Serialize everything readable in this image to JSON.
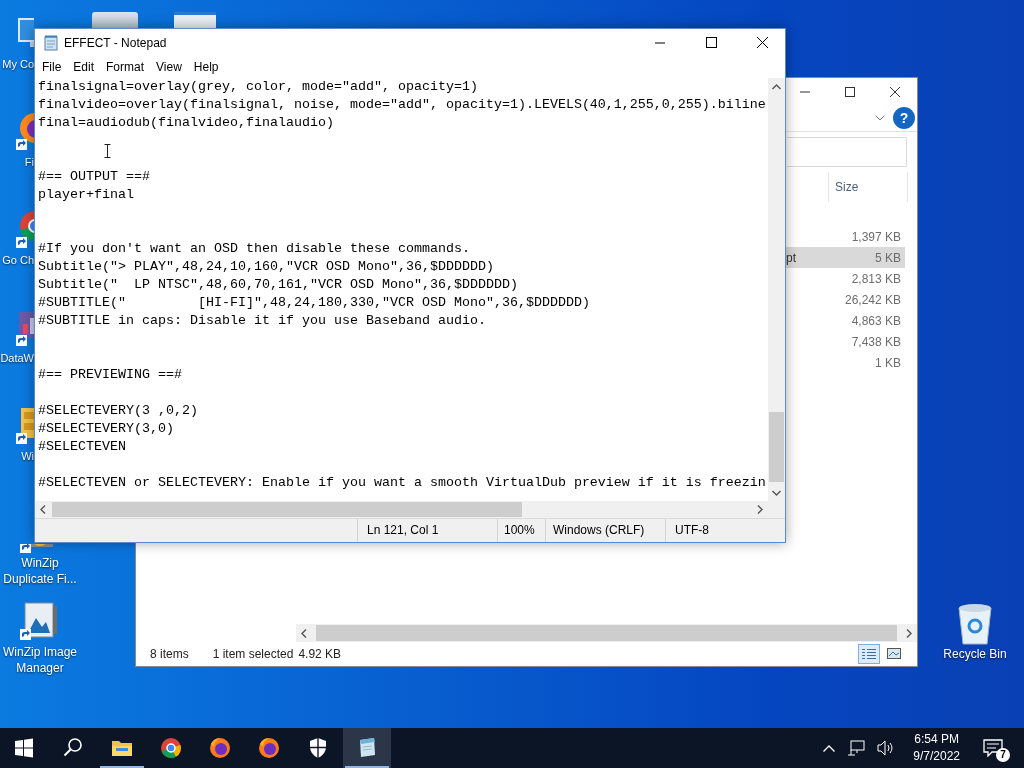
{
  "desktop_icons": [
    {
      "kind": "computer",
      "label": "My Co",
      "cut": true
    },
    {
      "kind": "fox",
      "label": "Fi",
      "cut": true
    },
    {
      "kind": "browser",
      "label": "Go Ch",
      "cut": true
    },
    {
      "kind": "chart",
      "label": "DataW",
      "cut": true
    },
    {
      "kind": "cabinet",
      "label": "Wi",
      "cut": true
    },
    {
      "kind": "zip",
      "label": "WinZip Duplicate Fi...",
      "cut": false
    },
    {
      "kind": "image",
      "label": "WinZip Image Manager",
      "cut": false
    }
  ],
  "recycle_bin": {
    "label": "Recycle Bin"
  },
  "explorer": {
    "help": "?",
    "size_header": "Size",
    "rows": [
      {
        "size": "1,397 KB",
        "selected": false
      },
      {
        "name": "pt",
        "size": "5 KB",
        "selected": true
      },
      {
        "size": "2,813 KB",
        "selected": false
      },
      {
        "size": "26,242 KB",
        "selected": false
      },
      {
        "size": "4,863 KB",
        "selected": false
      },
      {
        "size": "7,438 KB",
        "selected": false
      },
      {
        "size": "1 KB",
        "selected": false
      }
    ],
    "status": {
      "items": "8 items",
      "selection": "1 item selected",
      "selection_size": "4.92 KB"
    },
    "views": [
      {
        "kind": "details",
        "selected": true
      },
      {
        "kind": "tiles",
        "selected": false
      }
    ]
  },
  "notepad": {
    "title": "EFFECT - Notepad",
    "menu": [
      "File",
      "Edit",
      "Format",
      "View",
      "Help"
    ],
    "text": "finalsignal=overlay(grey, color, mode=\"add\", opacity=1)\nfinalvideo=overlay(finalsignal, noise, mode=\"add\", opacity=1).LEVELS(40,1,255,0,255).biline\nfinal=audiodub(finalvideo,finalaudio)\n\n\n#== OUTPUT ==#\nplayer+final\n\n\n#If you don't want an OSD then disable these commands.\nSubtitle(\"> PLAY\",48,24,10,160,\"VCR OSD Mono\",36,$DDDDDD)\nSubtitle(\"  LP NTSC\",48,60,70,161,\"VCR OSD Mono\",36,$DDDDDD)\n#SUBTITLE(\"         [HI-FI]\",48,24,180,330,\"VCR OSD Mono\",36,$DDDDDD)\n#SUBTITLE in caps: Disable it if you use Baseband audio.\n\n\n#== PREVIEWING ==#\n\n#SELECTEVERY(3 ,0,2)\n#SELECTEVERY(3,0)\n#SELECTEVEN\n\n#SELECTEVEN or SELECTEVERY: Enable if you want a smooth VirtualDub preview if it is freezin",
    "status": {
      "position": "Ln 121, Col 1",
      "zoom": "100%",
      "line_endings": "Windows (CRLF)",
      "encoding": "UTF-8"
    }
  },
  "taskbar": {
    "items": [
      {
        "kind": "start",
        "running": false,
        "active": false
      },
      {
        "kind": "search",
        "running": false,
        "active": false
      },
      {
        "kind": "folder",
        "running": true,
        "active": false
      },
      {
        "kind": "browser",
        "running": false,
        "active": false
      },
      {
        "kind": "fox",
        "running": false,
        "active": false
      },
      {
        "kind": "fox",
        "running": false,
        "active": false
      },
      {
        "kind": "shield",
        "running": false,
        "active": false
      },
      {
        "kind": "notepad",
        "running": true,
        "active": true
      }
    ],
    "clock": {
      "time": "6:54 PM",
      "date": "9/7/2022"
    },
    "notifications": "7"
  }
}
